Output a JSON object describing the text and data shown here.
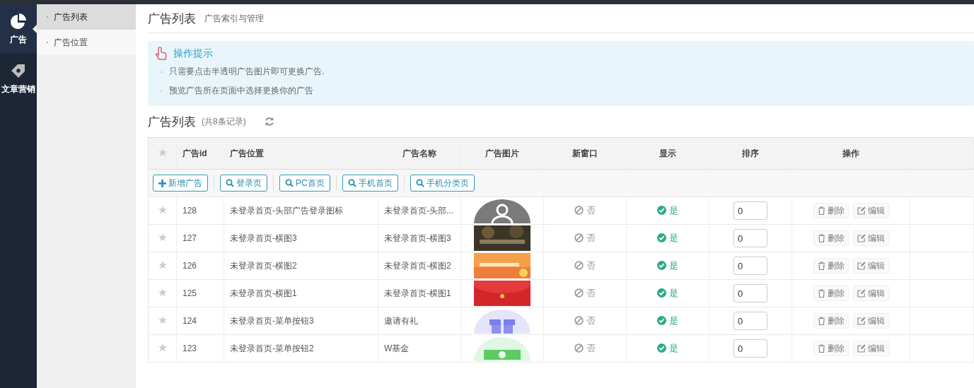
{
  "nav": [
    {
      "label": "广告",
      "kind": "pie",
      "selected": true
    },
    {
      "label": "文章营销",
      "kind": "tag",
      "selected": false
    }
  ],
  "subnav": [
    {
      "label": "广告列表",
      "selected": true
    },
    {
      "label": "广告位置",
      "selected": false
    }
  ],
  "header": {
    "title": "广告列表",
    "subtitle": "广告索引与管理"
  },
  "tips": {
    "title": "操作提示",
    "items": [
      "只需要点击半透明广告图片即可更换广告.",
      "预览广告所在页面中选择更换你的广告"
    ]
  },
  "list": {
    "title": "广告列表",
    "count": "(共8条记录)"
  },
  "table": {
    "columns": [
      "广告id",
      "广告位置",
      "广告名称",
      "广告图片",
      "新窗口",
      "显示",
      "排序",
      "操作"
    ],
    "toolbar": [
      {
        "label": "新增广告",
        "kind": "add"
      },
      {
        "label": "登录页",
        "kind": "search"
      },
      {
        "label": "PC首页",
        "kind": "search"
      },
      {
        "label": "手机首页",
        "kind": "search"
      },
      {
        "label": "手机分类页",
        "kind": "search"
      }
    ],
    "rows": [
      {
        "id": "128",
        "position": "未登录首页-头部广告登录图标",
        "name": "未登录首页-头部...",
        "new_window": false,
        "new_window_label": "否",
        "shown": true,
        "shown_label": "是",
        "sort": "0",
        "actions": [
          "删除",
          "编辑"
        ]
      },
      {
        "id": "127",
        "position": "未登录首页-横图3",
        "name": "未登录首页-横图3",
        "new_window": false,
        "new_window_label": "否",
        "shown": true,
        "shown_label": "是",
        "sort": "0",
        "actions": [
          "删除",
          "编辑"
        ]
      },
      {
        "id": "126",
        "position": "未登录首页-横图2",
        "name": "未登录首页-横图2",
        "new_window": false,
        "new_window_label": "否",
        "shown": true,
        "shown_label": "是",
        "sort": "0",
        "actions": [
          "删除",
          "编辑"
        ]
      },
      {
        "id": "125",
        "position": "未登录首页-横图1",
        "name": "未登录首页-横图1",
        "new_window": false,
        "new_window_label": "否",
        "shown": true,
        "shown_label": "是",
        "sort": "0",
        "actions": [
          "删除",
          "编辑"
        ]
      },
      {
        "id": "124",
        "position": "未登录首页-菜单按钮3",
        "name": "邀请有礼",
        "new_window": false,
        "new_window_label": "否",
        "shown": true,
        "shown_label": "是",
        "sort": "0",
        "actions": [
          "删除",
          "编辑"
        ]
      },
      {
        "id": "123",
        "position": "未登录首页-菜单按钮2",
        "name": "W基金",
        "new_window": false,
        "new_window_label": "否",
        "shown": true,
        "shown_label": "是",
        "sort": "0",
        "actions": [
          "删除",
          "编辑"
        ]
      }
    ]
  }
}
